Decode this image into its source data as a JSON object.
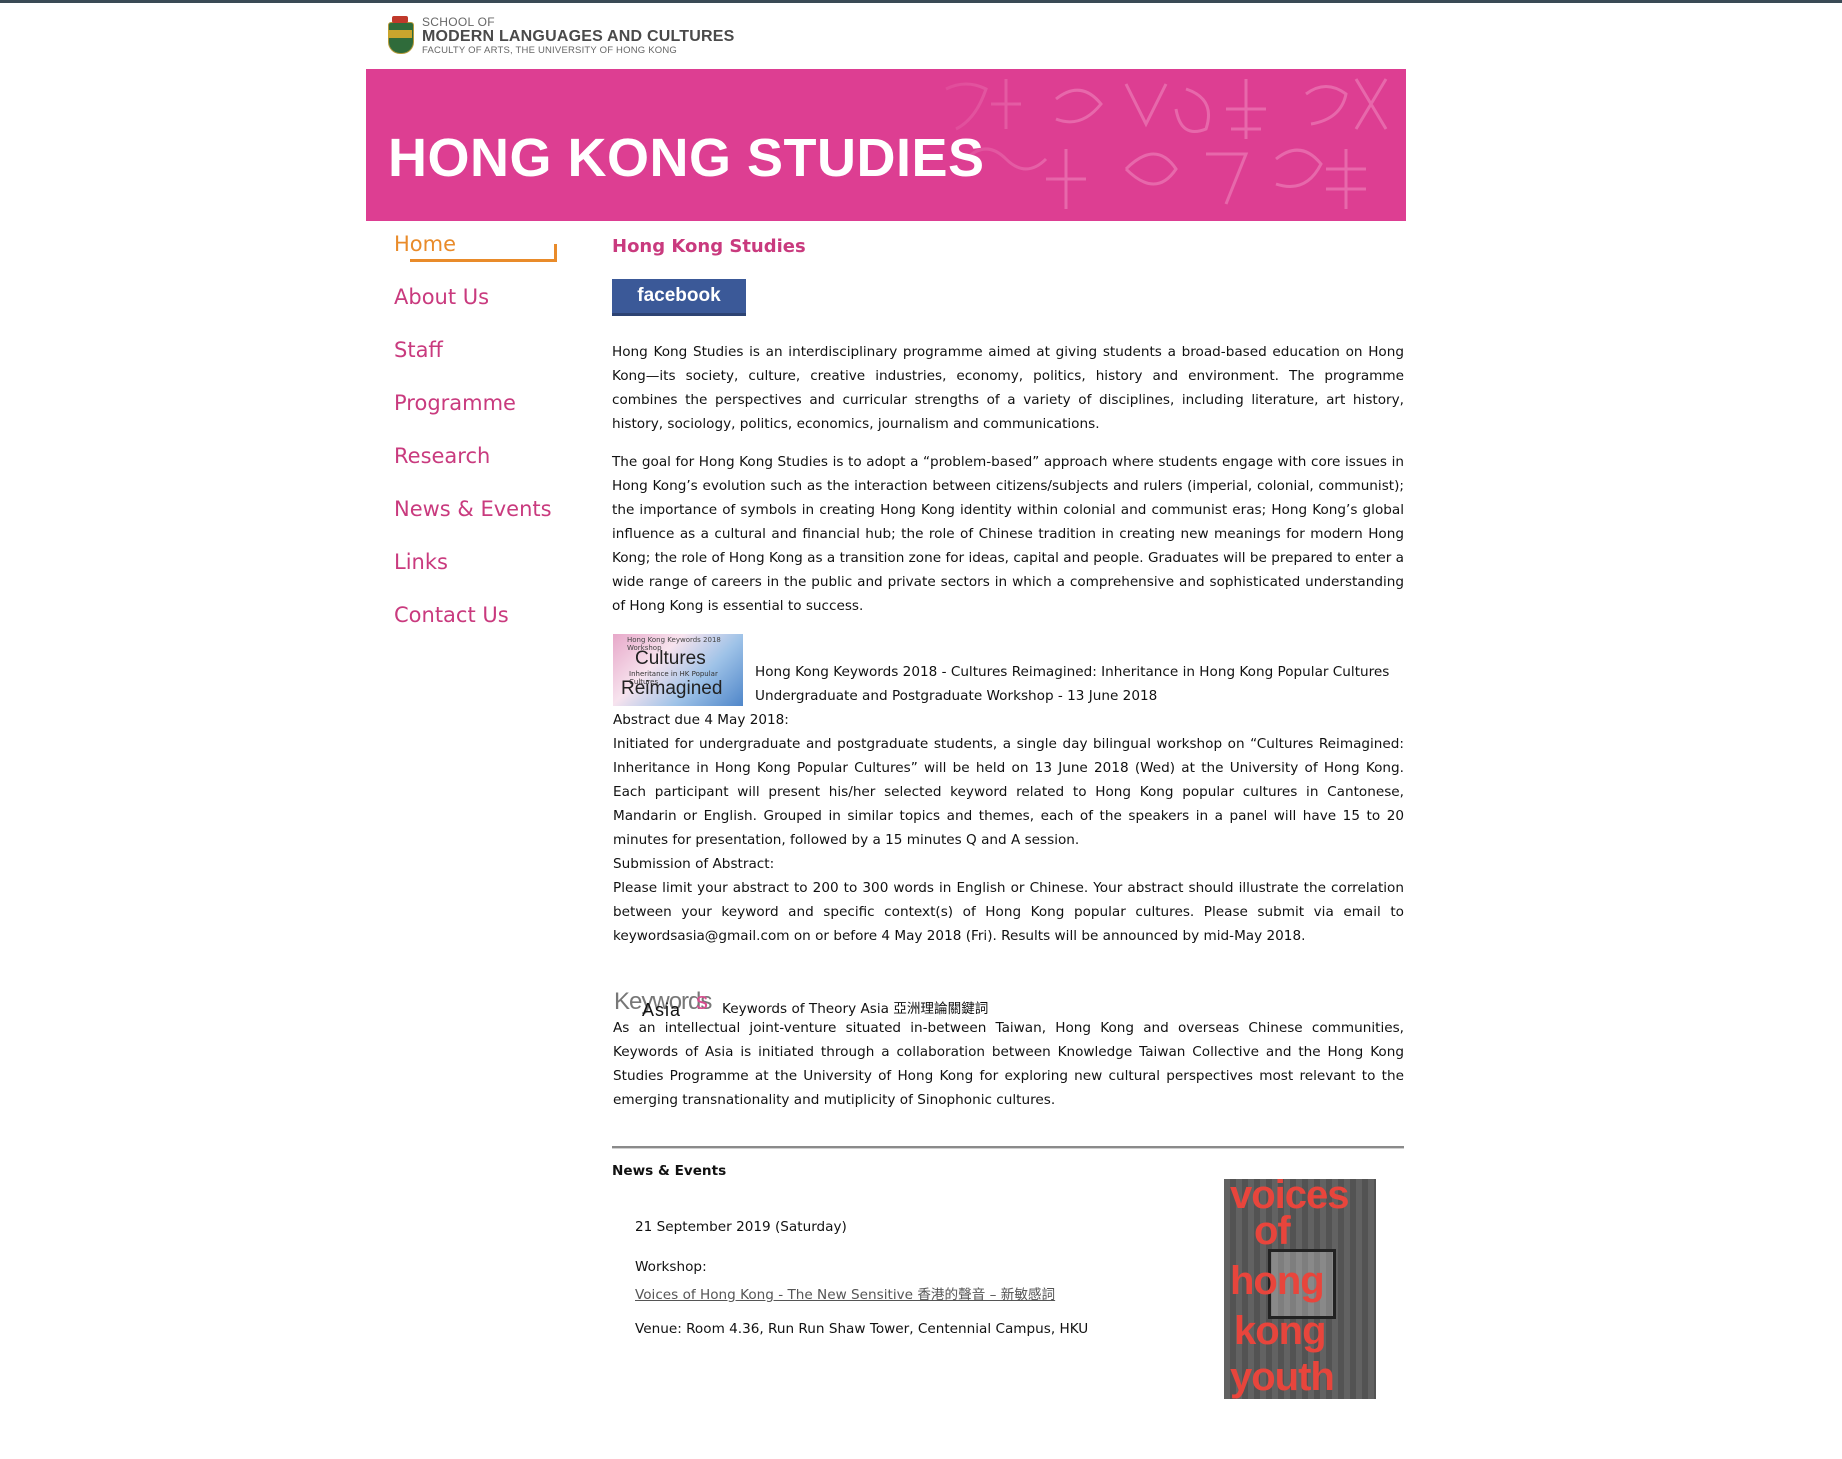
{
  "logo": {
    "line1": "SCHOOL OF",
    "line2": "MODERN LANGUAGES AND CULTURES",
    "line3": "FACULTY OF ARTS, THE UNIVERSITY OF HONG KONG"
  },
  "banner": {
    "title": "HONG KONG STUDIES"
  },
  "nav": {
    "items": [
      {
        "label": "Home",
        "active": true
      },
      {
        "label": "About Us"
      },
      {
        "label": "Staff"
      },
      {
        "label": "Programme"
      },
      {
        "label": "Research"
      },
      {
        "label": "News & Events"
      },
      {
        "label": "Links"
      },
      {
        "label": "Contact Us"
      }
    ]
  },
  "main": {
    "title": "Hong Kong Studies",
    "facebook_label": "facebook",
    "intro_1": "Hong Kong Studies is an interdisciplinary programme aimed at giving students a broad-based education on Hong Kong—its society, culture, creative industries, economy, politics, history and environment. The programme combines the perspectives and curricular strengths of a variety of disciplines, including literature, art history, history, sociology, politics, economics, journalism and communications.",
    "intro_2": "The goal for Hong Kong Studies is to adopt a “problem-based” approach where students engage with core issues in Hong Kong’s evolution such as the interaction between citizens/subjects and rulers (imperial, colonial, communist); the importance of symbols in creating Hong Kong identity within colonial and communist eras; Hong Kong’s global influence as a cultural and financial hub; the role of Chinese tradition in creating new meanings for modern Hong Kong; the role of Hong Kong as a transition zone for ideas, capital and people. Graduates will be prepared to enter a wide range of careers in the public and private sectors in which a comprehensive and sophisticated understanding of Hong Kong is essential to success."
  },
  "keywords_event": {
    "thumb_small": "Hong Kong Keywords 2018 Workshop",
    "thumb_big1": "Cultures",
    "thumb_mid": "Inheritance in HK Popular Cultures",
    "thumb_big2": "Reimagined",
    "title_line1": "Hong Kong Keywords 2018 - Cultures Reimagined: Inheritance in Hong Kong Popular Cultures",
    "title_line2": "Undergraduate and Postgraduate Workshop - 13 June 2018",
    "abstract_due": "Abstract due 4 May 2018:",
    "description": "Initiated for undergraduate and postgraduate students, a single day bilingual workshop on “Cultures Reimagined: Inheritance in Hong Kong Popular Cultures” will be held on 13 June 2018 (Wed) at the University of Hong Kong. Each participant will present his/her selected keyword related to Hong Kong popular cultures in Cantonese, Mandarin or English. Grouped in similar topics and themes, each of the speakers in a panel will have 15 to 20 minutes for presentation, followed by a 15 minutes Q and A session.",
    "submission_heading": "Submission of Abstract:",
    "submission_text": "Please limit your abstract to 200 to 300 words in English or Chinese. Your abstract should illustrate the correlation between your keyword and specific context(s) of Hong Kong popular cultures. Please submit via email to keywordsasia@gmail.com on or before 4 May 2018 (Fri). Results will be announced by mid-May 2018."
  },
  "theory_asia": {
    "logo_part1": "Keywords",
    "logo_part2": "s",
    "logo_part3": "Asia",
    "title": "Keywords of Theory Asia 亞洲理論關鍵詞",
    "description": "As an intellectual joint-venture situated in-between Taiwan, Hong Kong and overseas Chinese communities, Keywords of Asia is initiated through a collaboration between Knowledge Taiwan Collective and the Hong Kong Studies Programme at the University of Hong Kong for exploring new cultural perspectives most relevant to the emerging transnationality and mutiplicity of Sinophonic cultures."
  },
  "news": {
    "heading": "News & Events",
    "date": "21 September 2019 (Saturday)",
    "label": "Workshop:",
    "link": "Voices of Hong Kong - The New Sensitive 香港的聲音 – 新敏感詞",
    "venue": "Venue: Room 4.36, Run Run Shaw Tower, Centennial Campus, HKU",
    "poster_words": [
      "voices",
      "of",
      "hong",
      "kong",
      "youth"
    ]
  },
  "colors": {
    "brand_pink": "#dd3e92",
    "nav_pink": "#c93a7e",
    "nav_active": "#e98b2a",
    "facebook": "#3b5998"
  }
}
